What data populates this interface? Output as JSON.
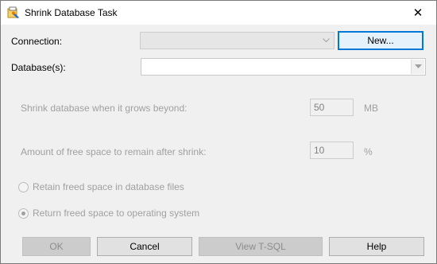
{
  "window": {
    "title": "Shrink Database Task",
    "icon": "task-wizard-icon",
    "close_glyph": "✕"
  },
  "connection": {
    "label": "Connection:",
    "value": "",
    "new_button": "New..."
  },
  "database": {
    "label": "Database(s):",
    "value": ""
  },
  "shrink_threshold": {
    "label": "Shrink database when it grows beyond:",
    "value": "50",
    "unit": "MB"
  },
  "free_space": {
    "label": "Amount of free space to remain after shrink:",
    "value": "10",
    "unit": "%"
  },
  "options": {
    "retain": {
      "label": "Retain freed space in database files",
      "selected": false
    },
    "return": {
      "label": "Return freed space to operating system",
      "selected": true
    }
  },
  "buttons": {
    "ok": "OK",
    "cancel": "Cancel",
    "view_tsql": "View T-SQL",
    "help": "Help"
  }
}
